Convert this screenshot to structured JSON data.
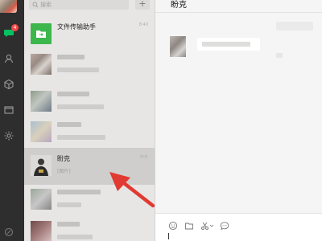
{
  "sidebar": {
    "unread_badge": "4",
    "icons": [
      "chat-icon",
      "contacts-icon",
      "favorites-icon",
      "folder-icon",
      "settings-icon",
      "more-icon"
    ]
  },
  "chatlist": {
    "search_placeholder": "搜索",
    "add_label": "+",
    "items": [
      {
        "name": "文件传输助手",
        "message": "",
        "time": "8:40"
      },
      {
        "name": "",
        "message": "",
        "time": ""
      },
      {
        "name": "",
        "message": "",
        "time": ""
      },
      {
        "name": "",
        "message": "",
        "time": ""
      },
      {
        "name": "盼克",
        "message": "[图片]",
        "time": "昨天"
      },
      {
        "name": "",
        "message": "",
        "time": ""
      },
      {
        "name": "",
        "message": "",
        "time": ""
      }
    ]
  },
  "chat": {
    "title": "盼克"
  },
  "colors": {
    "sidebar_bg": "#2e2e2e",
    "list_bg": "#e7e6e5",
    "selected_bg": "#cfcecd",
    "badge_red": "#f04848",
    "file_helper_green": "#3db74c",
    "arrow_red": "#e03a32"
  }
}
